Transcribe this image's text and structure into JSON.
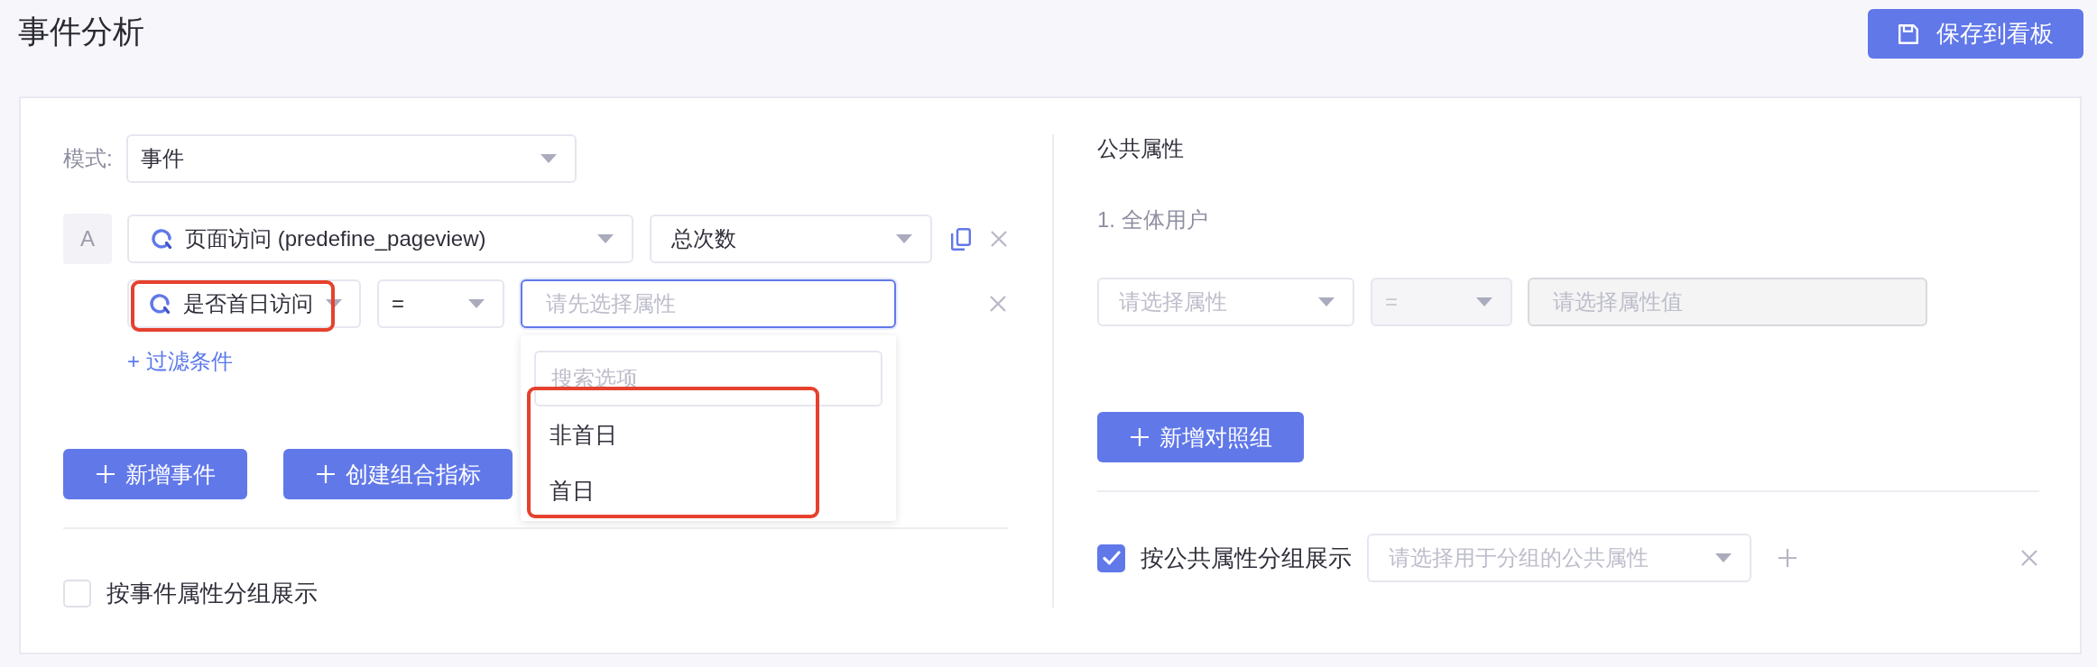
{
  "header": {
    "title": "事件分析",
    "save_button": "保存到看板"
  },
  "event_panel": {
    "mode": {
      "label": "模式:",
      "value": "事件"
    },
    "events": [
      {
        "badge": "A",
        "event": "页面访问 (predefine_pageview)",
        "metric": "总次数",
        "filters": [
          {
            "property": "是否首日访问",
            "highlighted": true,
            "operator": "=",
            "value_placeholder": "请先选择属性",
            "focused": true,
            "dropdown": {
              "search_placeholder": "搜索选项",
              "options": [
                "非首日",
                "首日"
              ],
              "highlighted": true
            }
          }
        ]
      }
    ],
    "add_filter": "+ 过滤条件",
    "buttons": [
      "新增事件",
      "创建组合指标"
    ],
    "group_by": {
      "label": "按事件属性分组展示",
      "checked": false
    }
  },
  "common_panel": {
    "title": "公共属性",
    "groups": [
      {
        "label": "1. 全体用户",
        "filter": {
          "property_placeholder": "请选择属性",
          "operator": "=",
          "operator_disabled": true,
          "value_placeholder": "请选择属性值",
          "value_disabled": true
        }
      }
    ],
    "add_group_button": "新增对照组",
    "group_by": {
      "label": "按公共属性分组展示",
      "checked": true,
      "placeholder": "请选择用于分组的公共属性"
    }
  }
}
